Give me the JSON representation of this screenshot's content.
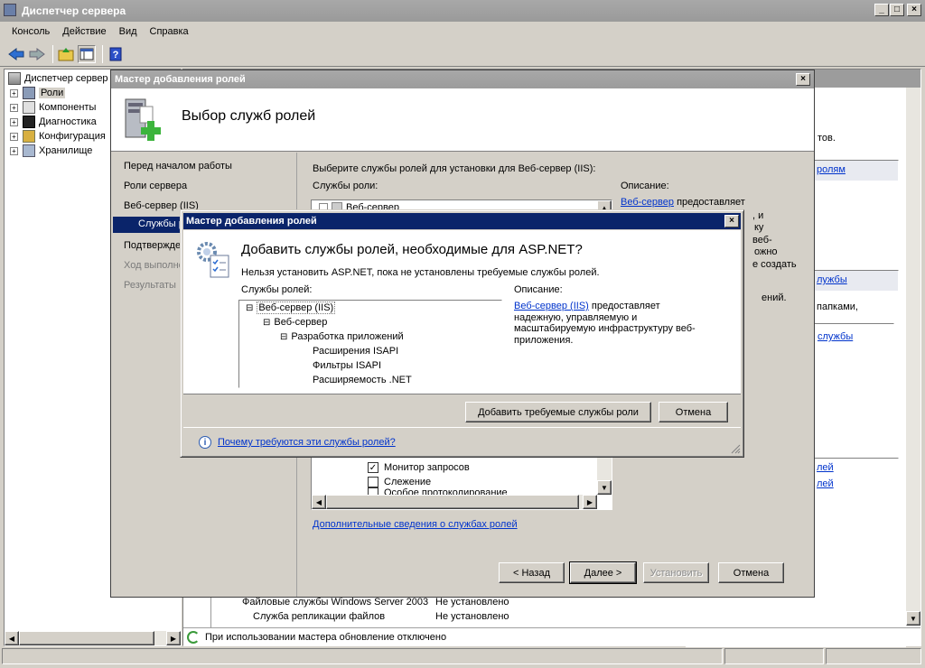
{
  "main": {
    "title": "Диспетчер сервера",
    "menu": [
      "Консоль",
      "Действие",
      "Вид",
      "Справка"
    ],
    "tree": [
      {
        "label": "Диспетчер сервер"
      },
      {
        "label": "Роли"
      },
      {
        "label": "Компоненты"
      },
      {
        "label": "Диагностика"
      },
      {
        "label": "Конфигурация"
      },
      {
        "label": "Хранилище"
      }
    ],
    "right": {
      "text_tov": "тов.",
      "link_roles": "ролям",
      "link_services": "лужбы",
      "text_folders": "папками,",
      "link_services2": "службы",
      "link_ley": "лей",
      "link_ley2": "лей"
    },
    "table": [
      {
        "name": "Файловые службы Windows Server 2003",
        "status": "Не установлено"
      },
      {
        "name": "Служба репликации файлов",
        "status": "Не установлено"
      }
    ],
    "status_text": "При использовании мастера обновление отключено"
  },
  "wizard": {
    "title": "Мастер добавления ролей",
    "header": "Выбор служб ролей",
    "nav": [
      {
        "label": "Перед началом работы",
        "state": "normal"
      },
      {
        "label": "Роли сервера",
        "state": "normal"
      },
      {
        "label": "Веб-сервер (IIS)",
        "state": "normal"
      },
      {
        "label": "Службы ролей",
        "state": "selected"
      },
      {
        "label": "Подтверждение",
        "state": "normal"
      },
      {
        "label": "Ход выполнения",
        "state": "disabled"
      },
      {
        "label": "Результаты",
        "state": "disabled"
      }
    ],
    "instruction": "Выберите службы ролей для установки для Веб-сервер (IIS):",
    "services_label": "Службы роли:",
    "list_top": "Веб-сервер",
    "list_items": [
      {
        "label": "Монитор запросов",
        "checked": true
      },
      {
        "label": "Слежение",
        "checked": false
      },
      {
        "label": "Особое протоколирование",
        "checked": false
      }
    ],
    "desc_label": "Описание:",
    "desc_link": "Веб-сервер",
    "desc_text": "предоставляет",
    "desc_fragments": [
      ", и",
      "ку",
      "веб-",
      "ожно",
      "е создать",
      "ений."
    ],
    "more_link": "Дополнительные сведения о службах ролей",
    "buttons": {
      "back": "< Назад",
      "next": "Далее >",
      "install": "Установить",
      "cancel": "Отмена"
    }
  },
  "dialog": {
    "title": "Мастер добавления ролей",
    "heading": "Добавить службы ролей, необходимые для ASP.NET?",
    "subtext": "Нельзя установить ASP.NET, пока не установлены требуемые службы ролей.",
    "services_label": "Службы ролей:",
    "desc_label": "Описание:",
    "tree": [
      {
        "label": "Веб-сервер (IIS)",
        "level": 0,
        "expander": "⊟"
      },
      {
        "label": "Веб-сервер",
        "level": 1,
        "expander": "⊟"
      },
      {
        "label": "Разработка приложений",
        "level": 2,
        "expander": "⊟"
      },
      {
        "label": "Расширения ISAPI",
        "level": 3,
        "expander": ""
      },
      {
        "label": "Фильтры ISAPI",
        "level": 3,
        "expander": ""
      },
      {
        "label": "Расширяемость .NET",
        "level": 3,
        "expander": ""
      }
    ],
    "desc_link": "Веб-сервер (IIS)",
    "desc_text": " предоставляет надежную, управляемую и масштабируемую инфраструктуру веб-приложения.",
    "add_button": "Добавить требуемые службы роли",
    "cancel_button": "Отмена",
    "help_link": "Почему требуются эти службы ролей?"
  }
}
